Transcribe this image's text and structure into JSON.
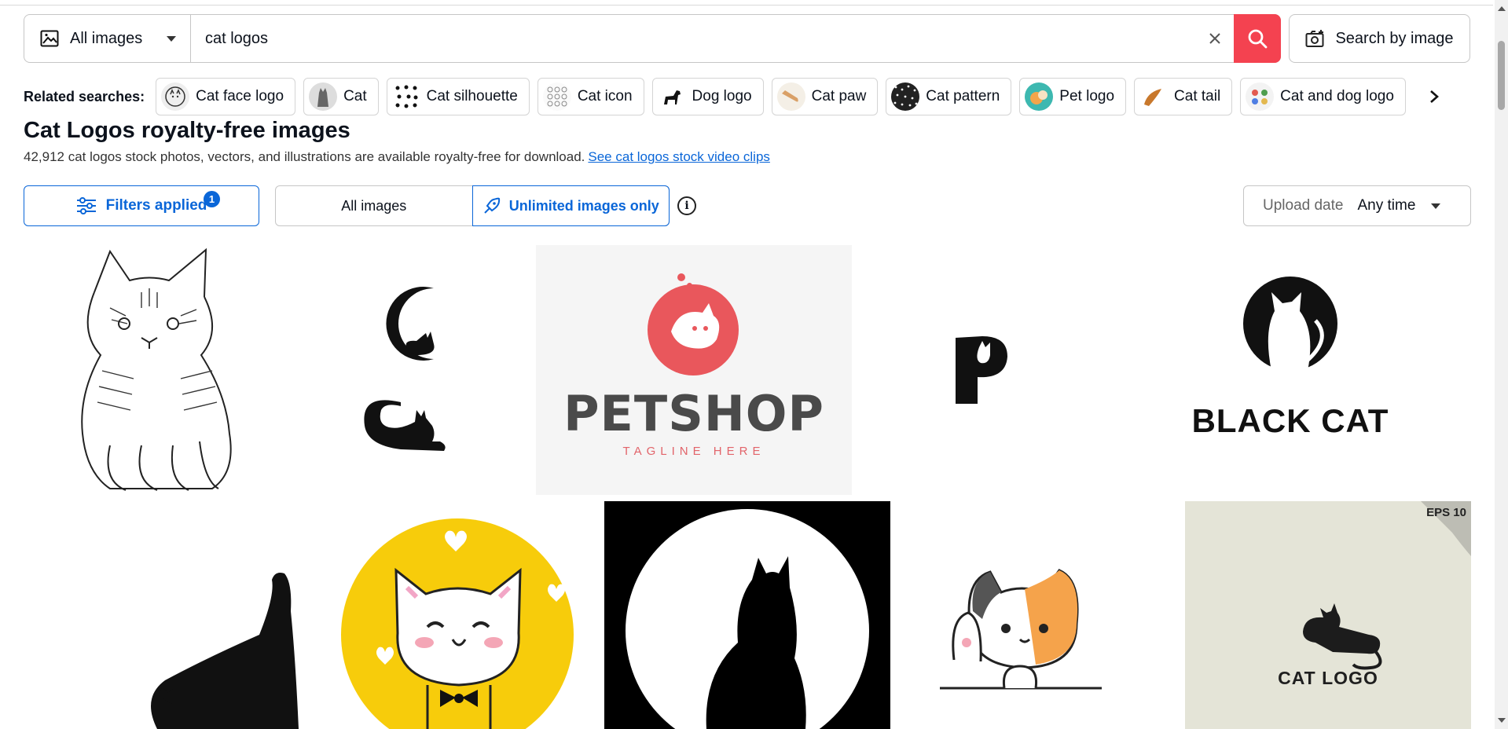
{
  "search": {
    "type_label": "All images",
    "query": "cat logos",
    "search_by_image_label": "Search by image"
  },
  "related": {
    "label": "Related searches:",
    "items": [
      {
        "label": "Cat face logo",
        "icon": "cat-face-logo-thumb"
      },
      {
        "label": "Cat",
        "icon": "cat-thumb"
      },
      {
        "label": "Cat silhouette",
        "icon": "cat-silhouette-thumb"
      },
      {
        "label": "Cat icon",
        "icon": "cat-icon-thumb"
      },
      {
        "label": "Dog logo",
        "icon": "dog-logo-thumb"
      },
      {
        "label": "Cat paw",
        "icon": "cat-paw-thumb"
      },
      {
        "label": "Cat pattern",
        "icon": "cat-pattern-thumb"
      },
      {
        "label": "Pet logo",
        "icon": "pet-logo-thumb"
      },
      {
        "label": "Cat tail",
        "icon": "cat-tail-thumb"
      },
      {
        "label": "Cat and dog logo",
        "icon": "cat-and-dog-logo-thumb"
      }
    ]
  },
  "page": {
    "title": "Cat Logos royalty-free images",
    "subtitle": "42,912 cat logos stock photos, vectors, and illustrations are available royalty-free for download.",
    "video_link": "See cat logos stock video clips"
  },
  "filters": {
    "applied_label": "Filters applied",
    "applied_count": "1",
    "seg_all": "All images",
    "seg_unlimited": "Unlimited images only",
    "upload_label": "Upload date",
    "upload_value": "Any time"
  },
  "images": {
    "petshop_title": "PETSHOP",
    "petshop_tagline": "TAGLINE HERE",
    "blackcat_title": "BLACK CAT",
    "catlogo_title": "CAT LOGO",
    "eps_badge": "EPS 10"
  },
  "colors": {
    "accent": "#0a66d8",
    "search_button": "#f44250",
    "yellow": "#f7cc0b",
    "pink": "#e2646a"
  }
}
